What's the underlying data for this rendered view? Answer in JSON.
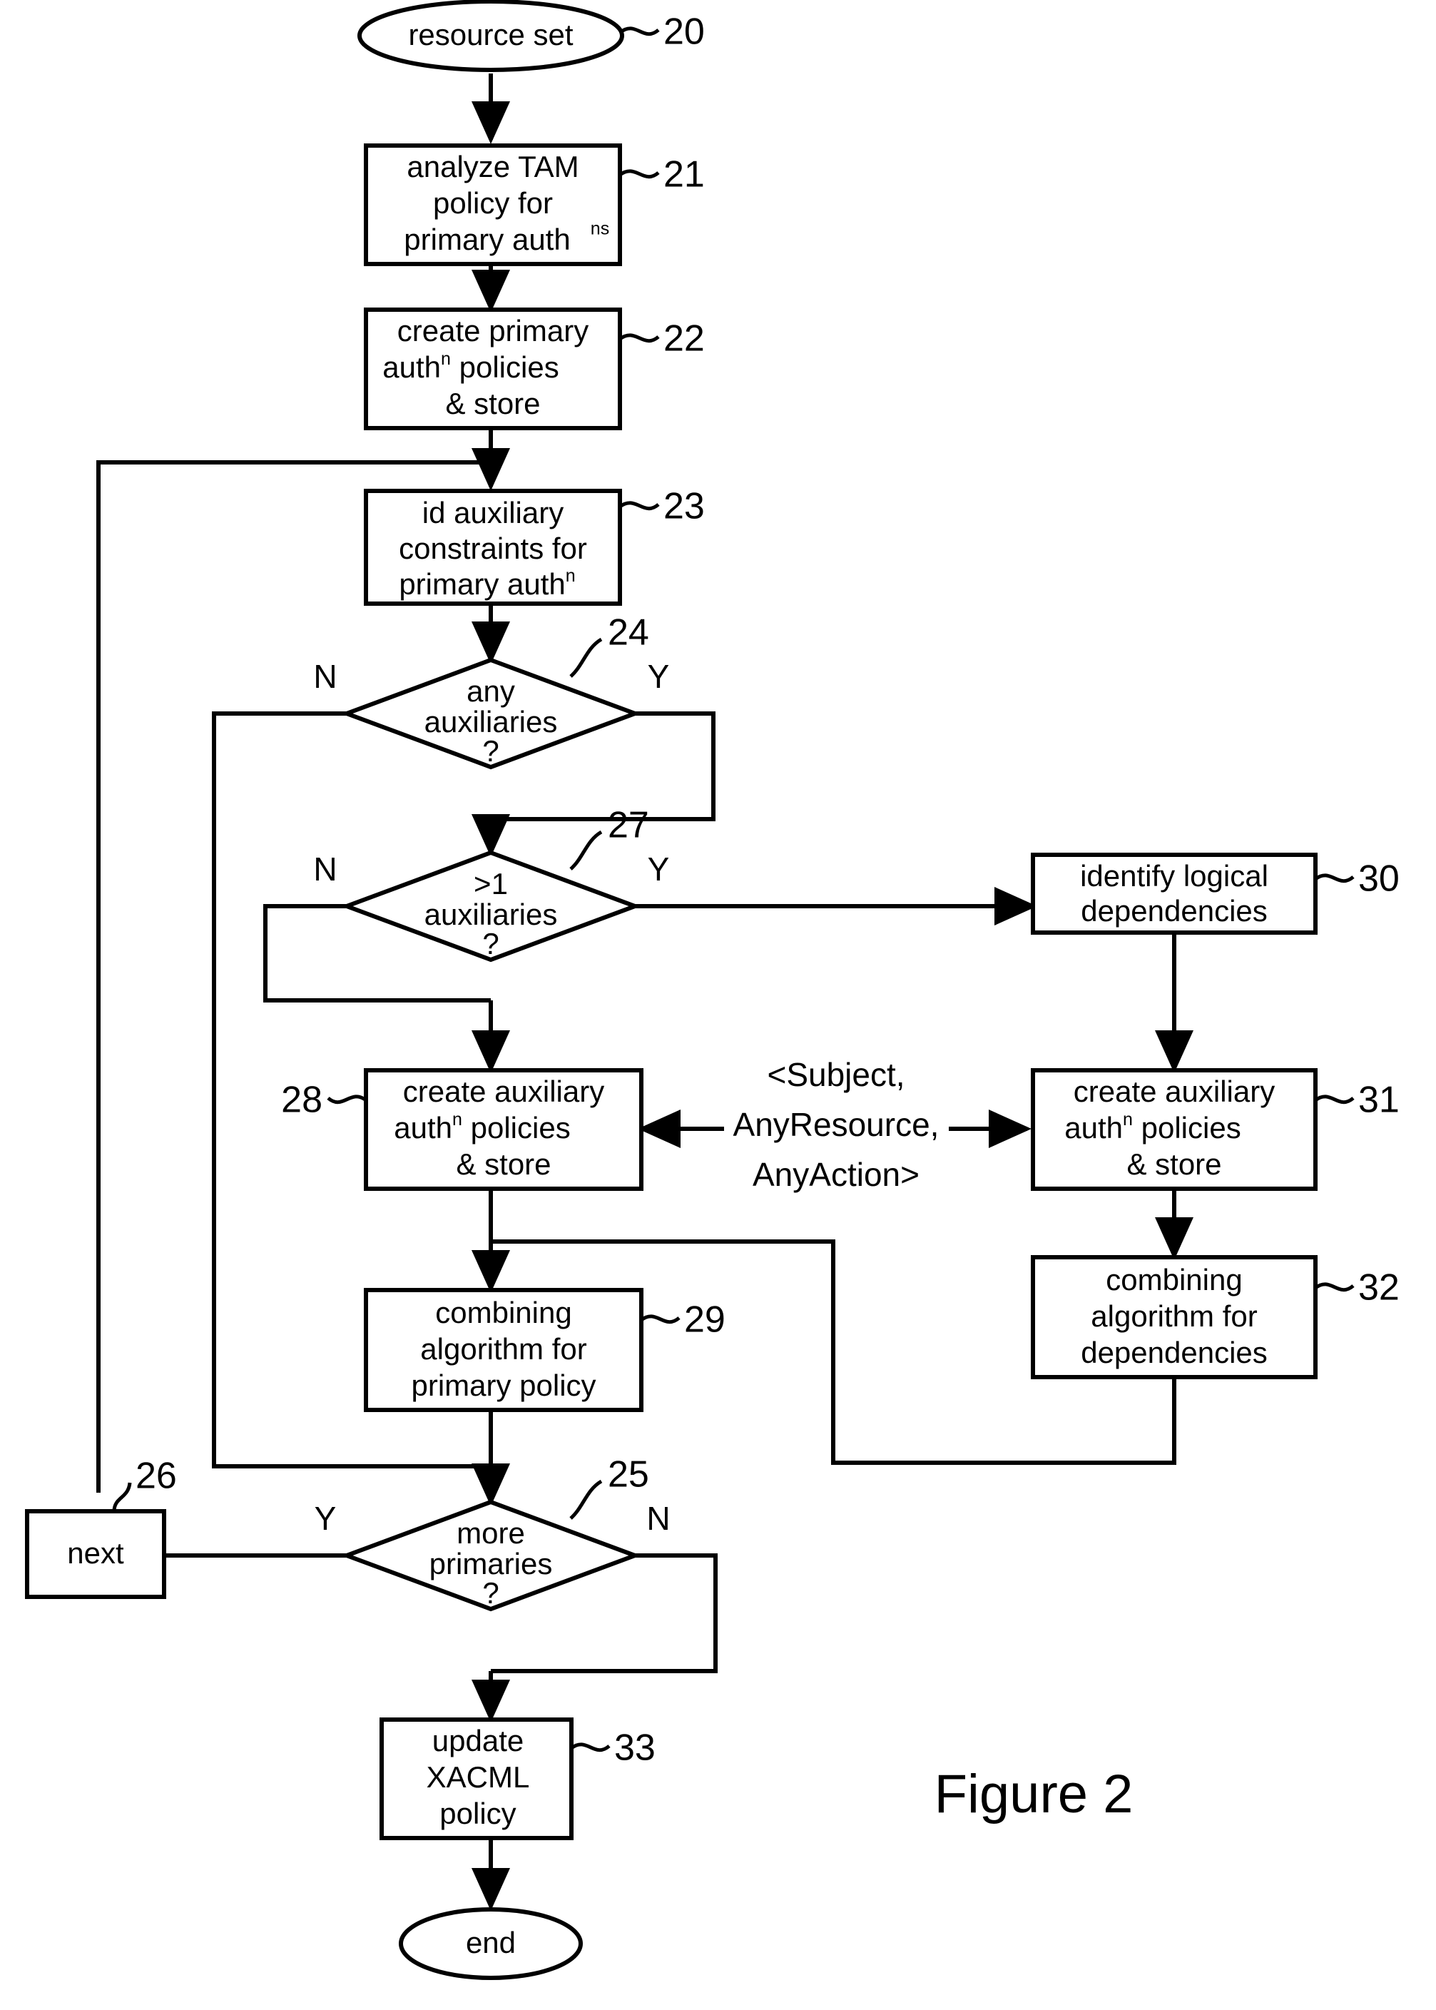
{
  "figure": {
    "caption": "Figure 2"
  },
  "nodes": {
    "start": {
      "ref": "20",
      "label": "resource set",
      "shape": "ellipse"
    },
    "analyze": {
      "ref": "21",
      "lines": [
        "analyze TAM",
        "policy for",
        "primary auth"
      ],
      "superscript": "ns",
      "shape": "process"
    },
    "create_primary": {
      "ref": "22",
      "lines": [
        "create primary",
        "auth",
        " policies",
        "& store"
      ],
      "line1": "create primary",
      "line2_pre": "auth",
      "line2_sup": "n",
      "line2_post": " policies",
      "line3": "& store",
      "shape": "process"
    },
    "id_aux": {
      "ref": "23",
      "line1": "id auxiliary",
      "line2": "constraints for",
      "line3_pre": "primary auth",
      "line3_sup": "n",
      "shape": "process"
    },
    "any_aux": {
      "ref": "24",
      "line1": "any",
      "line2": "auxiliaries",
      "line3": "?",
      "shape": "decision",
      "yes_label": "Y",
      "no_label": "N"
    },
    "gt1_aux": {
      "ref": "27",
      "line1": ">1",
      "line2": "auxiliaries",
      "line3": "?",
      "shape": "decision",
      "yes_label": "Y",
      "no_label": "N"
    },
    "identify_deps": {
      "ref": "30",
      "line1": "identify logical",
      "line2": "dependencies",
      "shape": "process"
    },
    "create_aux_left": {
      "ref": "28",
      "line1": "create auxiliary",
      "line2_pre": "auth",
      "line2_sup": "n",
      "line2_post": " policies",
      "line3": "& store",
      "shape": "process"
    },
    "create_aux_right": {
      "ref": "31",
      "line1": "create auxiliary",
      "line2_pre": "auth",
      "line2_sup": "n",
      "line2_post": " policies",
      "line3": "& store",
      "shape": "process"
    },
    "combine_primary": {
      "ref": "29",
      "line1": "combining",
      "line2": "algorithm for",
      "line3": "primary policy",
      "shape": "process"
    },
    "combine_deps": {
      "ref": "32",
      "line1": "combining",
      "line2": "algorithm for",
      "line3": "dependencies",
      "shape": "process"
    },
    "more_primaries": {
      "ref": "25",
      "line1": "more",
      "line2": "primaries",
      "line3": "?",
      "shape": "decision",
      "yes_label": "Y",
      "no_label": "N"
    },
    "next": {
      "ref": "26",
      "label": "next",
      "shape": "process"
    },
    "update_xacml": {
      "ref": "33",
      "line1": "update",
      "line2": "XACML",
      "line3": "policy",
      "shape": "process"
    },
    "end": {
      "label": "end",
      "shape": "ellipse"
    }
  },
  "annotations": {
    "tuple": {
      "line1": "<Subject,",
      "line2": "AnyResource,",
      "line3": "AnyAction>"
    }
  },
  "colors": {
    "stroke": "#000000",
    "fill": "#ffffff",
    "text": "#000000"
  }
}
